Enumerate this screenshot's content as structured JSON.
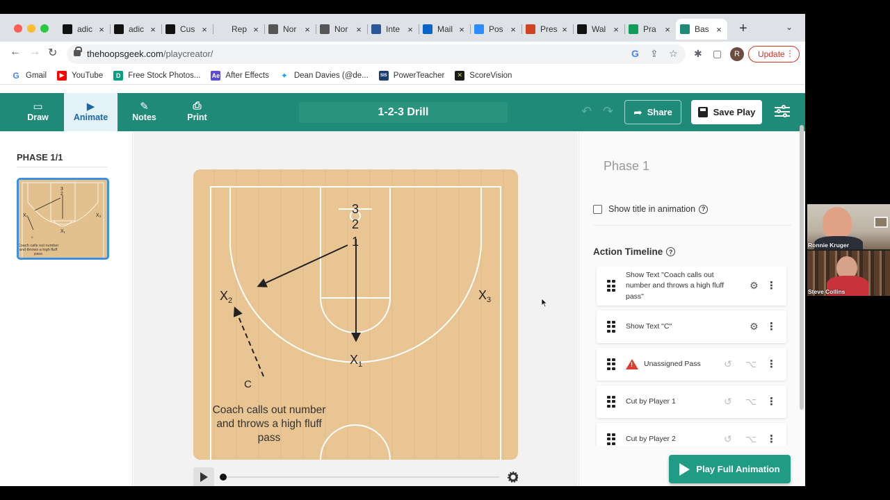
{
  "browser": {
    "tabs": [
      {
        "title": "adic",
        "icon": "adidas-icon",
        "color": "#111111"
      },
      {
        "title": "adic",
        "icon": "adidas-icon",
        "color": "#111111"
      },
      {
        "title": "Cus",
        "icon": "adidas-icon",
        "color": "#111111"
      },
      {
        "title": "Rep",
        "icon": "blank-icon",
        "color": "#dee1e6"
      },
      {
        "title": "Nor",
        "icon": "globe-icon",
        "color": "#555555"
      },
      {
        "title": "Nor",
        "icon": "globe-icon",
        "color": "#555555"
      },
      {
        "title": "Inte",
        "icon": "word-icon",
        "color": "#2b579a"
      },
      {
        "title": "Mail",
        "icon": "outlook-icon",
        "color": "#0a64c8"
      },
      {
        "title": "Pos",
        "icon": "zoom-icon",
        "color": "#2d8cff"
      },
      {
        "title": "Pres",
        "icon": "powerpoint-icon",
        "color": "#d04423"
      },
      {
        "title": "Wal",
        "icon": "x-icon",
        "color": "#111111"
      },
      {
        "title": "Pra",
        "icon": "sheets-icon",
        "color": "#0f9d58"
      },
      {
        "title": "Bas",
        "icon": "basketball-icon",
        "color": "#1f8a78"
      }
    ],
    "url_host": "thehoopsgeek.com",
    "url_path": "/playcreator/",
    "profile_initial": "R",
    "update_label": "Update",
    "bookmarks": [
      {
        "label": "Gmail",
        "icon": "google-icon",
        "color": "#ffffff",
        "glyph": "G"
      },
      {
        "label": "YouTube",
        "icon": "youtube-icon",
        "color": "#ff0000",
        "glyph": "▶"
      },
      {
        "label": "Free Stock Photos...",
        "icon": "photos-icon",
        "color": "#05a081",
        "glyph": "D"
      },
      {
        "label": "After Effects",
        "icon": "after-effects-icon",
        "color": "#5b4bd6",
        "glyph": "Ae"
      },
      {
        "label": "Dean Davies (@de...",
        "icon": "twitter-icon",
        "color": "#1da1f2",
        "glyph": "✦"
      },
      {
        "label": "PowerTeacher",
        "icon": "powerteacher-icon",
        "color": "#1c3d6e",
        "glyph": "SIS"
      },
      {
        "label": "ScoreVision",
        "icon": "scorevision-icon",
        "color": "#6a8f1b",
        "glyph": "✕"
      }
    ]
  },
  "app": {
    "modes": [
      {
        "label": "Draw",
        "icon": "laptop-icon",
        "glyph": "▭",
        "active": false
      },
      {
        "label": "Animate",
        "icon": "play-icon",
        "glyph": "▶",
        "active": true
      },
      {
        "label": "Notes",
        "icon": "pencil-icon",
        "glyph": "✎",
        "active": false
      },
      {
        "label": "Print",
        "icon": "printer-icon",
        "glyph": "⎙",
        "active": false
      }
    ],
    "play_title": "1-2-3 Drill",
    "share_label": "Share",
    "save_label": "Save Play",
    "colors": {
      "header": "#1f8a78",
      "accent_blue": "#3d8fe0",
      "play_button": "#1f9c83",
      "court": "#e8c592"
    }
  },
  "left_panel": {
    "phase_label": "PHASE 1/1",
    "thumbnail_caption": "Coach calls out number and throws a high fluff pass"
  },
  "court": {
    "labels": {
      "n3": "3",
      "n2": "2",
      "n1": "1",
      "x1": "X",
      "x1_sub": "1",
      "x2": "X",
      "x2_sub": "2",
      "x3": "X",
      "x3_sub": "3",
      "coach": "C"
    },
    "caption_lines": [
      "Coach calls out number",
      "and throws a high fluff",
      "pass"
    ],
    "playback_progress": 0
  },
  "right_panel": {
    "phase_name": "Phase 1",
    "show_title_label": "Show title in animation",
    "show_title_checked": false,
    "timeline_title": "Action Timeline",
    "actions": [
      {
        "label": "Show Text \"Coach calls out number and throws a high fluff pass\"",
        "warning": false,
        "assigned": true
      },
      {
        "label": "Show Text \"C\"",
        "warning": false,
        "assigned": true
      },
      {
        "label": "Unassigned Pass",
        "warning": true,
        "assigned": false
      },
      {
        "label": "Cut by Player 1",
        "warning": false,
        "assigned": false
      },
      {
        "label": "Cut by Player 2",
        "warning": false,
        "assigned": false
      }
    ],
    "play_full_label": "Play Full Animation"
  },
  "webcam": {
    "participants": [
      "Ronnie Kruger",
      "Steve Collins"
    ]
  }
}
